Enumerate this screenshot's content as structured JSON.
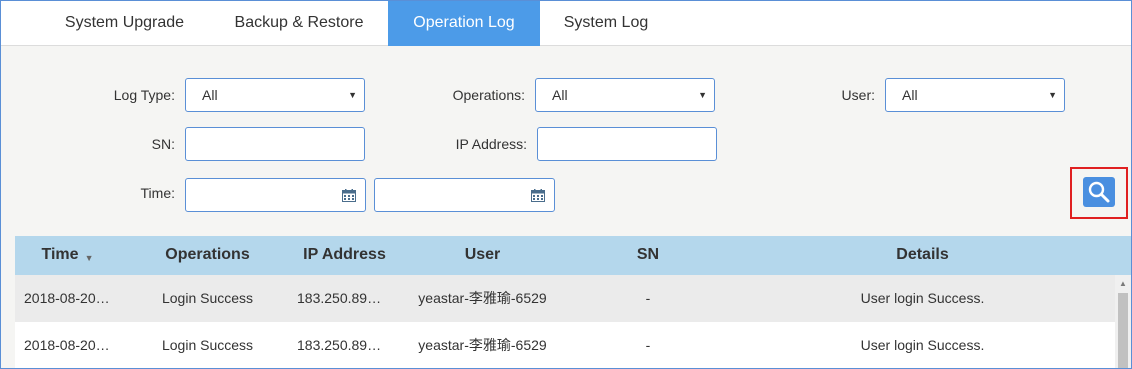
{
  "tabs": [
    {
      "label": "System Upgrade",
      "active": false
    },
    {
      "label": "Backup & Restore",
      "active": false
    },
    {
      "label": "Operation Log",
      "active": true
    },
    {
      "label": "System Log",
      "active": false
    }
  ],
  "filters": {
    "log_type": {
      "label": "Log Type:",
      "value": "All"
    },
    "operations": {
      "label": "Operations:",
      "value": "All"
    },
    "user": {
      "label": "User:",
      "value": "All"
    },
    "sn": {
      "label": "SN:",
      "value": ""
    },
    "ip_address": {
      "label": "IP Address:",
      "value": ""
    },
    "time": {
      "label": "Time:",
      "start": "",
      "end": ""
    }
  },
  "search_icon": "search-icon",
  "table": {
    "columns": [
      "Time",
      "Operations",
      "IP Address",
      "User",
      "SN",
      "Details"
    ],
    "sorted_column": "Time",
    "rows": [
      {
        "time": "2018-08-20…",
        "operations": "Login Success",
        "ip": "183.250.89…",
        "user": "yeastar-李雅瑜-6529",
        "sn": "-",
        "details": "User login Success."
      },
      {
        "time": "2018-08-20…",
        "operations": "Login Success",
        "ip": "183.250.89…",
        "user": "yeastar-李雅瑜-6529",
        "sn": "-",
        "details": "User login Success."
      }
    ]
  },
  "colors": {
    "accent": "#4c9be8",
    "table_header": "#b4d7ec",
    "highlight": "#e02020"
  }
}
